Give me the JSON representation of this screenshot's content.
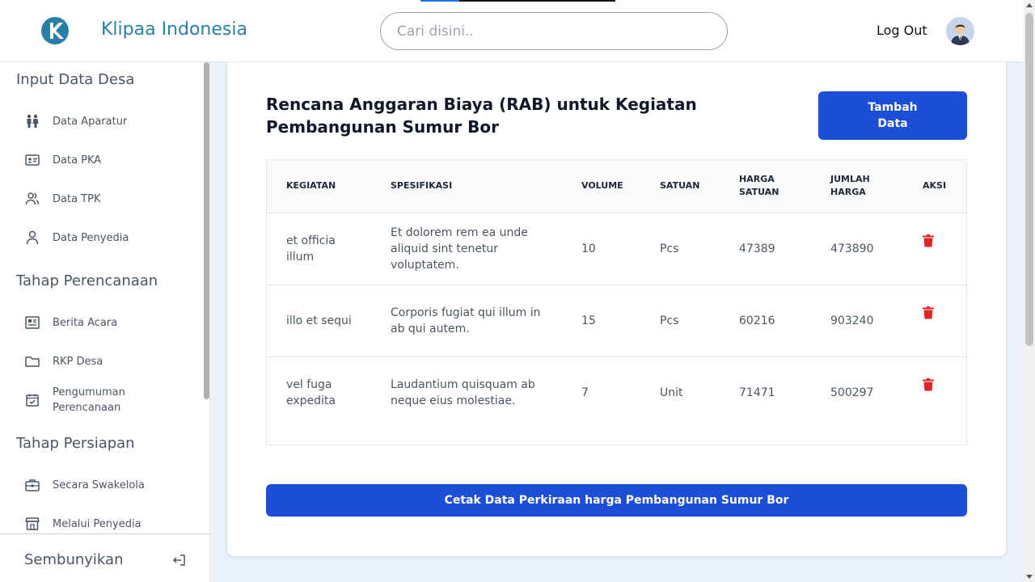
{
  "header": {
    "brand": "Klipaa Indonesia",
    "search_placeholder": "Cari disini..",
    "logout_label": "Log Out"
  },
  "sidebar": {
    "sections": [
      {
        "title": "Input Data Desa"
      },
      {
        "title": "Tahap Perencanaan"
      },
      {
        "title": "Tahap Persiapan"
      }
    ],
    "items": [
      {
        "label": "Data Aparatur",
        "icon": "people-icon"
      },
      {
        "label": "Data PKA",
        "icon": "id-card-icon"
      },
      {
        "label": "Data TPK",
        "icon": "users-icon"
      },
      {
        "label": "Data Penyedia",
        "icon": "user-icon"
      },
      {
        "label": "Berita Acara",
        "icon": "newspaper-icon"
      },
      {
        "label": "RKP Desa",
        "icon": "folder-icon"
      },
      {
        "label": "Pengumuman Perencanaan",
        "icon": "calendar-check-icon"
      },
      {
        "label": "Secara Swakelola",
        "icon": "briefcase-icon"
      },
      {
        "label": "Melalui Penyedia",
        "icon": "store-icon"
      }
    ],
    "footer_label": "Sembunyikan"
  },
  "main": {
    "title": "Rencana Anggaran Biaya (RAB) untuk Kegiatan Pembangunan Sumur Bor",
    "add_button": "Tambah Data",
    "print_button": "Cetak Data Perkiraan harga Pembangunan Sumur Bor",
    "table": {
      "headers": [
        "KEGIATAN",
        "SPESIFIKASI",
        "VOLUME",
        "SATUAN",
        "HARGA SATUAN",
        "JUMLAH HARGA",
        "AKSI"
      ],
      "rows": [
        {
          "kegiatan": "et officia illum",
          "spesifikasi": "Et dolorem rem ea unde aliquid sint tenetur voluptatem.",
          "volume": "10",
          "satuan": "Pcs",
          "harga_satuan": "47389",
          "jumlah_harga": "473890"
        },
        {
          "kegiatan": "illo et sequi",
          "spesifikasi": "Corporis fugiat qui illum in ab qui autem.",
          "volume": "15",
          "satuan": "Pcs",
          "harga_satuan": "60216",
          "jumlah_harga": "903240"
        },
        {
          "kegiatan": "vel fuga expedita",
          "spesifikasi": "Laudantium quisquam ab neque eius molestiae.",
          "volume": "7",
          "satuan": "Unit",
          "harga_satuan": "71471",
          "jumlah_harga": "500297"
        }
      ]
    }
  },
  "colors": {
    "brand": "#2a7fa8",
    "primary_button": "#1d4ed8",
    "delete_icon": "#dc2626",
    "background": "#eaf1fb"
  }
}
